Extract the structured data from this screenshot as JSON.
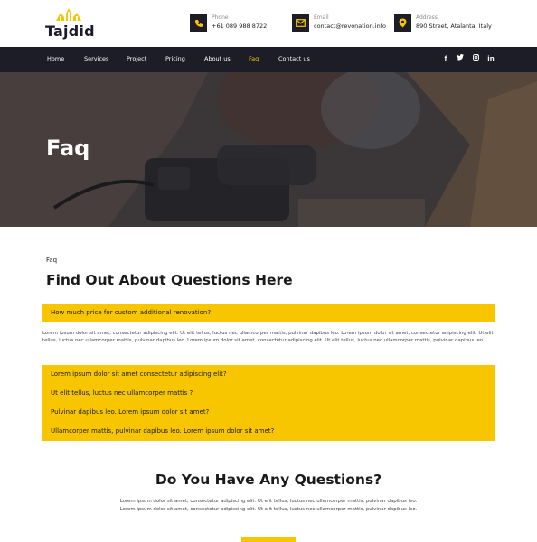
{
  "brand": {
    "name": "Tajdid",
    "accent": "#f7c600",
    "dark": "#1d1d27"
  },
  "contacts": [
    {
      "icon": "phone-icon",
      "label": "Phone",
      "value": "+61 089 988 8722"
    },
    {
      "icon": "mail-icon",
      "label": "Email",
      "value": "contact@revonation.info"
    },
    {
      "icon": "location-pin-icon",
      "label": "Address",
      "value": "890 Street, Atalanta, Italy"
    }
  ],
  "nav": {
    "items": [
      "Home",
      "Services",
      "Project",
      "Pricing",
      "About us",
      "Faq",
      "Contact us"
    ],
    "active": "Faq",
    "social": [
      "facebook-icon",
      "twitter-icon",
      "instagram-icon",
      "linkedin-icon"
    ]
  },
  "hero": {
    "title": "Faq"
  },
  "faq": {
    "eyebrow": "Faq",
    "title": "Find Out About Questions Here",
    "open_question": "How much price for custom additional renovation?",
    "answer": "Lorem ipsum dolor sit amet, consectetur adipiscing elit. Ut elit tellus, luctus nec ullamcorper mattis, pulvinar dapibus leo. Lorem ipsum dolor sit amet, consectetur adipiscing elit. Ut elit tellus, luctus nec ullamcorper mattis, pulvinar dapibus leo. Lorem ipsum dolor sit amet, consectetur adipiscing elit. Ut elit tellus, luctus nec ullamcorper mattis, pulvinar dapibus leo.",
    "questions": [
      "Lorem ipsum dolor sit amet consectetur adipiscing elit?",
      "Ut elit tellus, luctus nec ullamcorper mattis ?",
      "Pulvinar dapibus leo. Lorem ipsum dolor sit amet?",
      "Ullamcorper mattis, pulvinar dapibus leo. Lorem ipsum dolor sit amet?"
    ]
  },
  "cta": {
    "title": "Do You Have Any Questions?",
    "text": "Lorem ipsum dolor sit amet, consectetur adipiscing elit. Ut elit tellus, luctus nec ullamcorper mattis, pulvinar dapibus leo. Lorem ipsum dolor sit amet, consectetur adipiscing elit. Ut elit tellus, luctus nec ullamcorper mattis, pulvinar dapibus leo."
  }
}
